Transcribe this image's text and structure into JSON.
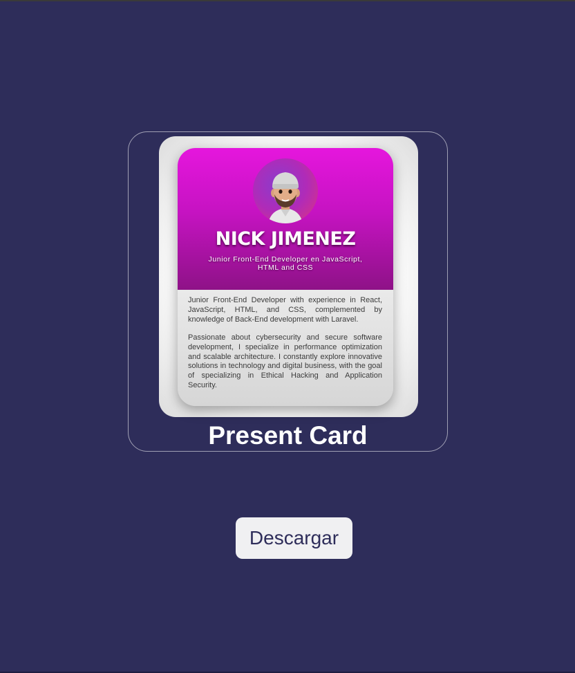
{
  "card": {
    "name": "NICK JIMENEZ",
    "role": "Junior Front-End Developer en JavaScript, HTML and CSS",
    "bio_paragraph_1": "Junior Front-End Developer with experience in React, JavaScript, HTML, and CSS, complemented by knowledge of Back-End development with Laravel.",
    "bio_paragraph_2": "Passionate about cybersecurity and secure software development, I specialize in performance optimization and scalable architecture. I constantly explore innovative solutions in technology and digital business, with the goal of specializing in Ethical Hacking and Application Security.",
    "avatar_icon": "memoji-avatar-icon"
  },
  "caption": "Present Card",
  "download_button": {
    "label": "Descargar"
  },
  "colors": {
    "background": "#2e2d5a",
    "header_gradient_top": "#e516dd",
    "header_gradient_bottom": "#8e1287",
    "button_bg": "#f0f0f2"
  }
}
